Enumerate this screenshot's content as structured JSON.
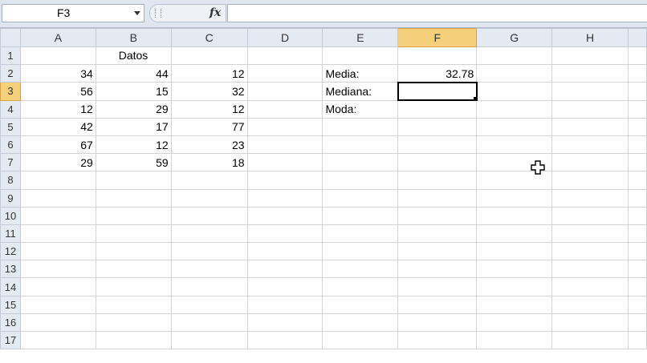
{
  "name_box": {
    "value": "F3"
  },
  "formula_bar": {
    "fx_label": "fx",
    "value": ""
  },
  "columns": [
    "A",
    "B",
    "C",
    "D",
    "E",
    "F",
    "G",
    "H"
  ],
  "rows": [
    "1",
    "2",
    "3",
    "4",
    "5",
    "6",
    "7",
    "8",
    "9",
    "10",
    "11",
    "12",
    "13",
    "14",
    "15",
    "16",
    "17"
  ],
  "cells": {
    "B1": "Datos",
    "A2": "34",
    "B2": "44",
    "C2": "12",
    "A3": "56",
    "B3": "15",
    "C3": "32",
    "A4": "12",
    "B4": "29",
    "C4": "12",
    "A5": "42",
    "B5": "17",
    "C5": "77",
    "A6": "67",
    "B6": "12",
    "C6": "23",
    "A7": "29",
    "B7": "59",
    "C7": "18",
    "E2": "Media:",
    "F2": "32.78",
    "E3": "Mediana:",
    "E4": "Moda:"
  },
  "selected_cell": "F3",
  "colors": {
    "header_bg": "#e4eaf2",
    "selected_header": "#f6cf7b",
    "gridline": "#d4d4d4"
  },
  "cursor": {
    "icon": "cell-select-cross-icon"
  }
}
